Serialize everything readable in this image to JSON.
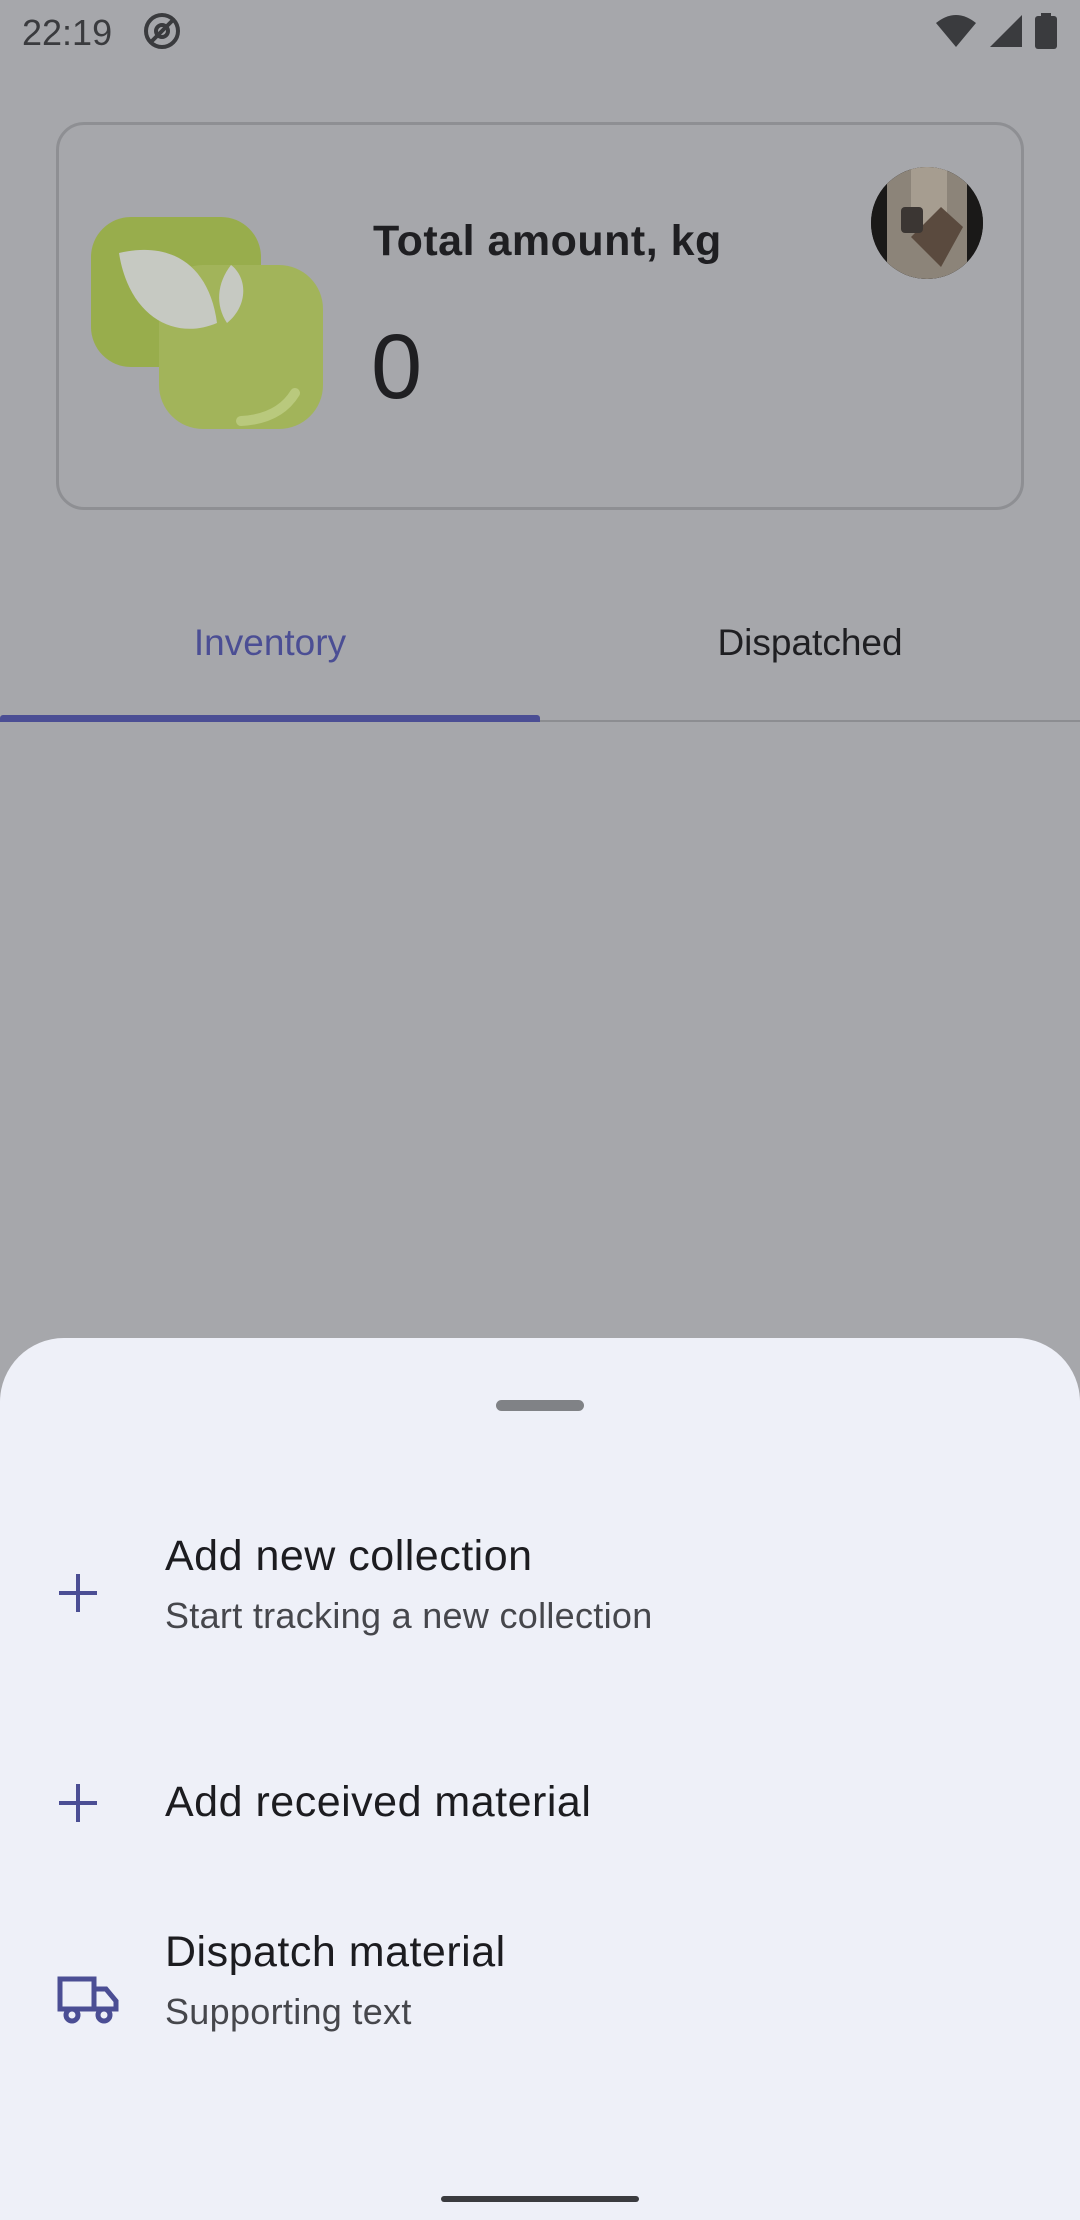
{
  "status_bar": {
    "time": "22:19",
    "icons": [
      "at-sign-icon",
      "wifi-icon",
      "signal-icon",
      "battery-icon"
    ]
  },
  "summary": {
    "total_label": "Total amount, kg",
    "total_value": "0"
  },
  "tabs": [
    {
      "label": "Inventory",
      "active": true
    },
    {
      "label": "Dispatched",
      "active": false
    }
  ],
  "sheet": {
    "items": [
      {
        "title": "Add new collection",
        "subtitle": "Start tracking a new collection",
        "icon": "plus-icon"
      },
      {
        "title": "Add received material",
        "icon": "plus-icon"
      },
      {
        "title": "Dispatch material",
        "subtitle": "Supporting text",
        "icon": "truck-icon"
      }
    ]
  },
  "colors": {
    "accent": "#4b4e94",
    "scrim": "#a6a7ab",
    "sheet_bg": "#eef0f8",
    "logo_green": "#9cb253"
  }
}
